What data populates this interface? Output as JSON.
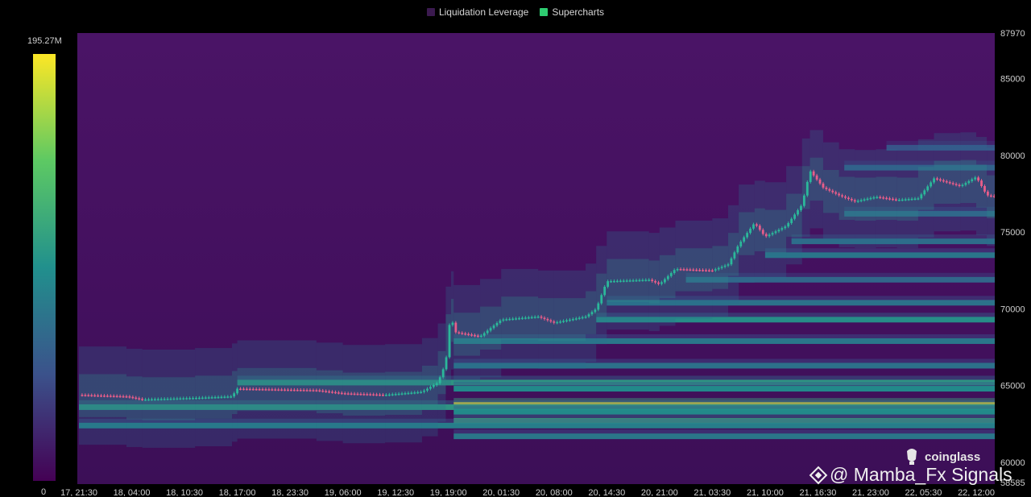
{
  "legend": [
    {
      "label": "Liquidation Leverage",
      "color": "#3b1a4f"
    },
    {
      "label": "Supercharts",
      "color": "#2ecc71"
    }
  ],
  "colorbar": {
    "max_label": "195.27M",
    "min_label": "0"
  },
  "watermark": {
    "brand": "coinglass",
    "user": "@ Mamba_Fx Signals"
  },
  "colors": {
    "up": "#2bb89a",
    "down": "#e85d8a",
    "background": "#000000"
  },
  "chart_data": {
    "type": "heatmap",
    "ylim": [
      58585,
      87970
    ],
    "y_ticks": [
      60000,
      65000,
      70000,
      75000,
      80000,
      85000
    ],
    "y_top_label": "87970",
    "y_bottom_label": "58585",
    "x_labels": [
      "17, 21:30",
      "18, 04:00",
      "18, 10:30",
      "18, 17:00",
      "18, 23:30",
      "19, 06:00",
      "19, 12:30",
      "19, 19:00",
      "20, 01:30",
      "20, 08:00",
      "20, 14:30",
      "20, 21:00",
      "21, 03:30",
      "21, 10:00",
      "21, 16:30",
      "21, 23:00",
      "22, 05:30",
      "22, 12:00"
    ],
    "price_path": [
      {
        "t": 0,
        "p": 64400
      },
      {
        "t": 0.9,
        "p": 64300
      },
      {
        "t": 1.2,
        "p": 64100
      },
      {
        "t": 2.2,
        "p": 64200
      },
      {
        "t": 2.9,
        "p": 64300
      },
      {
        "t": 3.0,
        "p": 64800
      },
      {
        "t": 4.5,
        "p": 64700
      },
      {
        "t": 5.0,
        "p": 64500
      },
      {
        "t": 5.8,
        "p": 64400
      },
      {
        "t": 6.5,
        "p": 64600
      },
      {
        "t": 6.8,
        "p": 65200
      },
      {
        "t": 6.95,
        "p": 66500
      },
      {
        "t": 7.05,
        "p": 70000
      },
      {
        "t": 7.1,
        "p": 68500
      },
      {
        "t": 7.6,
        "p": 68200
      },
      {
        "t": 8.0,
        "p": 69300
      },
      {
        "t": 8.7,
        "p": 69500
      },
      {
        "t": 9.0,
        "p": 69100
      },
      {
        "t": 9.6,
        "p": 69500
      },
      {
        "t": 9.8,
        "p": 70000
      },
      {
        "t": 10.0,
        "p": 71800
      },
      {
        "t": 10.8,
        "p": 71900
      },
      {
        "t": 11.0,
        "p": 71600
      },
      {
        "t": 11.3,
        "p": 72600
      },
      {
        "t": 12.0,
        "p": 72500
      },
      {
        "t": 12.3,
        "p": 72900
      },
      {
        "t": 12.5,
        "p": 74200
      },
      {
        "t": 12.8,
        "p": 75600
      },
      {
        "t": 13.0,
        "p": 74700
      },
      {
        "t": 13.4,
        "p": 75400
      },
      {
        "t": 13.7,
        "p": 76800
      },
      {
        "t": 13.85,
        "p": 79000
      },
      {
        "t": 14.1,
        "p": 77900
      },
      {
        "t": 14.4,
        "p": 77400
      },
      {
        "t": 14.7,
        "p": 77000
      },
      {
        "t": 15.1,
        "p": 77300
      },
      {
        "t": 15.5,
        "p": 77100
      },
      {
        "t": 15.9,
        "p": 77200
      },
      {
        "t": 16.2,
        "p": 78500
      },
      {
        "t": 16.7,
        "p": 78000
      },
      {
        "t": 17.0,
        "p": 78600
      },
      {
        "t": 17.2,
        "p": 77400
      },
      {
        "t": 17.6,
        "p": 77200
      },
      {
        "t": 18.0,
        "p": 76900
      },
      {
        "t": 18.4,
        "p": 77100
      },
      {
        "t": 18.7,
        "p": 77000
      }
    ],
    "liquidation_bands": [
      {
        "price": 63800,
        "intensity": 1.0,
        "from": 7.1
      },
      {
        "price": 63600,
        "intensity": 0.55,
        "from": 0
      },
      {
        "price": 63300,
        "intensity": 0.5,
        "from": 7.1
      },
      {
        "price": 62700,
        "intensity": 0.6,
        "from": 7.1
      },
      {
        "price": 62400,
        "intensity": 0.45,
        "from": 0
      },
      {
        "price": 61700,
        "intensity": 0.42,
        "from": 7.1
      },
      {
        "price": 65200,
        "intensity": 0.55,
        "from": 3.0
      },
      {
        "price": 64800,
        "intensity": 0.5,
        "from": 7.1
      },
      {
        "price": 66300,
        "intensity": 0.4,
        "from": 7.1
      },
      {
        "price": 67900,
        "intensity": 0.42,
        "from": 7.1
      },
      {
        "price": 69300,
        "intensity": 0.52,
        "from": 9.8
      },
      {
        "price": 70400,
        "intensity": 0.4,
        "from": 10.0
      },
      {
        "price": 71900,
        "intensity": 0.35,
        "from": 11.5
      },
      {
        "price": 73500,
        "intensity": 0.42,
        "from": 13.0
      },
      {
        "price": 74400,
        "intensity": 0.38,
        "from": 13.5
      },
      {
        "price": 76200,
        "intensity": 0.35,
        "from": 14.5
      },
      {
        "price": 79200,
        "intensity": 0.32,
        "from": 14.5
      },
      {
        "price": 80500,
        "intensity": 0.28,
        "from": 15.3
      }
    ]
  }
}
